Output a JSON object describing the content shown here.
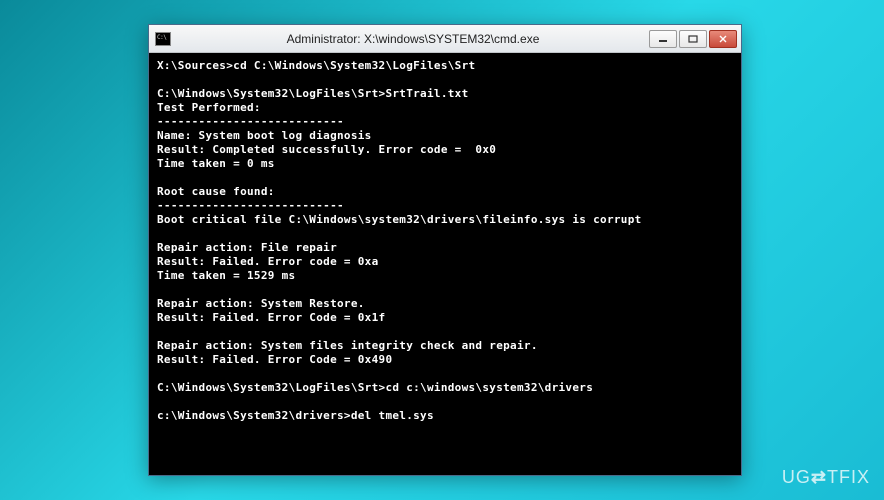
{
  "window": {
    "title": "Administrator: X:\\windows\\SYSTEM32\\cmd.exe"
  },
  "console": {
    "lines": [
      "X:\\Sources>cd C:\\Windows\\System32\\LogFiles\\Srt",
      "",
      "C:\\Windows\\System32\\LogFiles\\Srt>SrtTrail.txt",
      "Test Performed:",
      "---------------------------",
      "Name: System boot log diagnosis",
      "Result: Completed successfully. Error code =  0x0",
      "Time taken = 0 ms",
      "",
      "Root cause found:",
      "---------------------------",
      "Boot critical file C:\\Windows\\system32\\drivers\\fileinfo.sys is corrupt",
      "",
      "Repair action: File repair",
      "Result: Failed. Error code = 0xa",
      "Time taken = 1529 ms",
      "",
      "Repair action: System Restore.",
      "Result: Failed. Error Code = 0x1f",
      "",
      "Repair action: System files integrity check and repair.",
      "Result: Failed. Error Code = 0x490",
      "",
      "C:\\Windows\\System32\\LogFiles\\Srt>cd c:\\windows\\system32\\drivers",
      "",
      "c:\\Windows\\System32\\drivers>del tmel.sys"
    ]
  },
  "watermark": {
    "prefix": "UG",
    "arrow": "⇄",
    "suffix": "TFIX"
  }
}
